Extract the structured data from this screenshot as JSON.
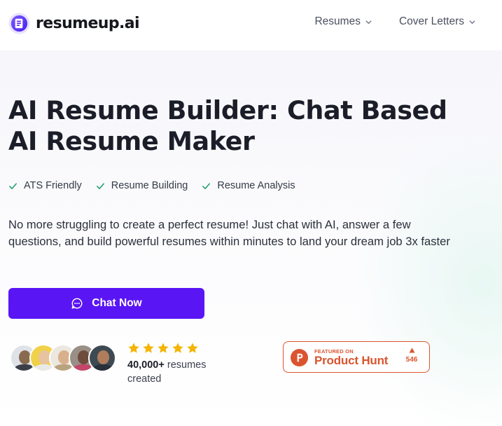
{
  "brand": {
    "name": "resumeup.ai",
    "accent": "#5a15f5"
  },
  "nav": {
    "items": [
      {
        "label": "Resumes"
      },
      {
        "label": "Cover Letters"
      }
    ]
  },
  "hero": {
    "title_line1": "AI Resume Builder: Chat Based",
    "title_line2": "AI Resume Maker",
    "features": [
      "ATS Friendly",
      "Resume Building",
      "Resume Analysis"
    ],
    "description": "No more struggling to create a perfect resume! Just chat with AI, answer a few questions, and build powerful resumes within minutes to land your dream job 3x faster",
    "cta_label": "Chat Now"
  },
  "social_proof": {
    "rating_stars": 5,
    "count": "40,000+",
    "count_suffix": "resumes created"
  },
  "product_hunt": {
    "featured_label": "FEATURED ON",
    "name": "Product Hunt",
    "votes": "546",
    "color": "#da552f"
  },
  "colors": {
    "check": "#22a06b",
    "star": "#f4b400"
  }
}
